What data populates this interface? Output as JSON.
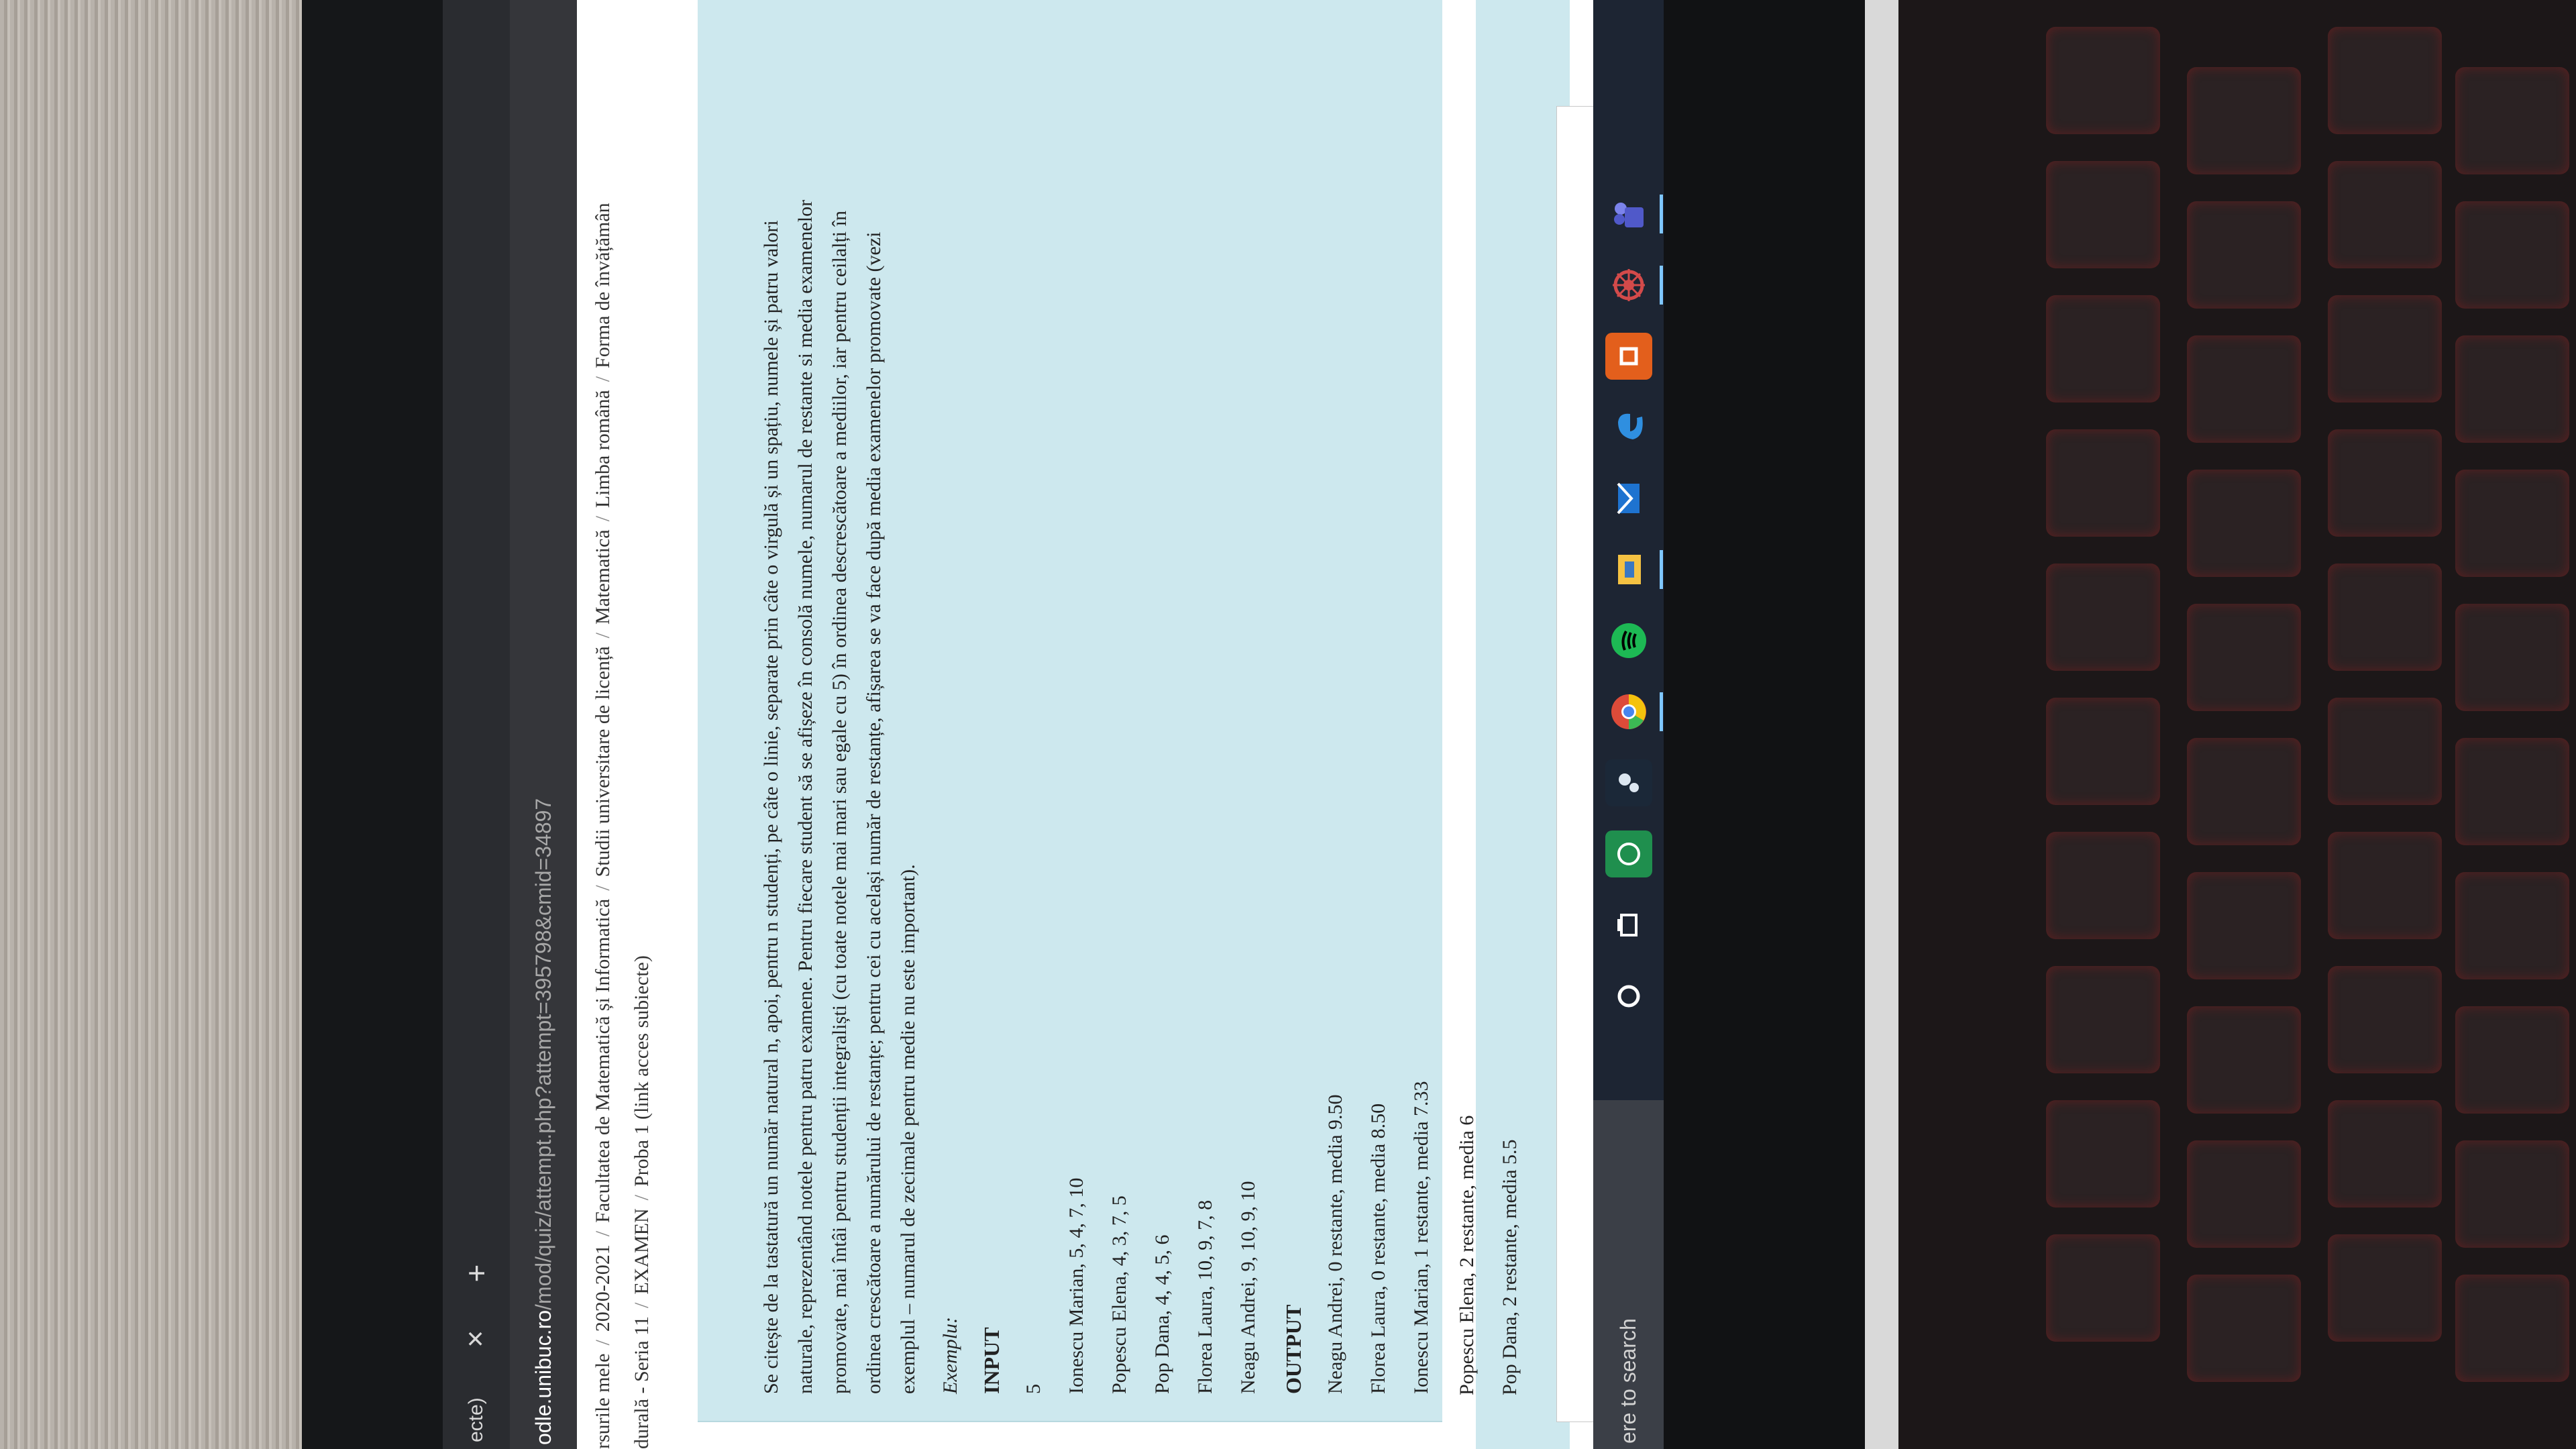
{
  "browser": {
    "tab_title": "ecte)",
    "tab_close": "✕",
    "new_tab": "+",
    "url_host": "odle.unibuc.ro",
    "url_path": "/mod/quiz/attempt.php?attempt=395798&cmid=34897"
  },
  "breadcrumb": {
    "items": [
      "rsurile mele",
      "2020-2021",
      "Facultatea de Matematică și Informatică",
      "Studii universitare de licență",
      "Matematică",
      "Limba română",
      "Forma de învățămân"
    ],
    "items2": [
      "durală - Seria 11",
      "EXAMEN",
      "Proba 1 (link acces subiecte)"
    ],
    "separator": "/"
  },
  "question": {
    "line1": "Se citește de la tastatură un număr natural n, apoi, pentru n studenți, pe câte o linie, separate prin câte o virgulă și un spațiu, numele și patru valori",
    "line2": "naturale, reprezentând notele pentru patru examene. Pentru fiecare student să se afișeze în consolă numele, numarul de restante si media examenelor",
    "line3": "promovate, mai întâi pentru studenții integraliști (cu toate notele mai mari sau egale cu 5) în ordinea descrescătoare a mediilor, iar pentru ceilalți în",
    "line4": "ordinea crescătoare a numărului de restanțe; pentru cei cu același număr de restanțe, afișarea se va face după media examenelor promovate (vezi",
    "line5": "exemplul – numarul de zecimale pentru medie nu este important).",
    "example_label": "Exemplu:",
    "input_label": "INPUT",
    "input_lines": [
      "5",
      "Ionescu Marian, 5, 4, 7, 10",
      "Popescu Elena, 4, 3, 7, 5",
      "Pop Dana, 4, 4, 5, 6",
      "Florea Laura, 10, 9, 7, 8",
      "Neagu Andrei, 9, 10, 9, 10"
    ],
    "output_label": "OUTPUT",
    "output_lines": [
      "Neagu Andrei, 0 restante, media 9.50",
      "Florea Laura, 0 restante, media 8.50",
      "Ionescu Marian, 1 restante, media 7.33",
      "Popescu Elena, 2 restante, media 6",
      "Pop Dana, 2 restante, media 5.5"
    ]
  },
  "taskbar": {
    "search_placeholder": "ere to search",
    "icons": [
      "cortana-icon",
      "task-view-icon",
      "whatsapp-icon",
      "steam-icon",
      "chrome-icon",
      "spotify-icon",
      "file-explorer-icon",
      "mail-icon",
      "edge-icon",
      "office-icon",
      "settings-icon",
      "teams-icon"
    ]
  }
}
